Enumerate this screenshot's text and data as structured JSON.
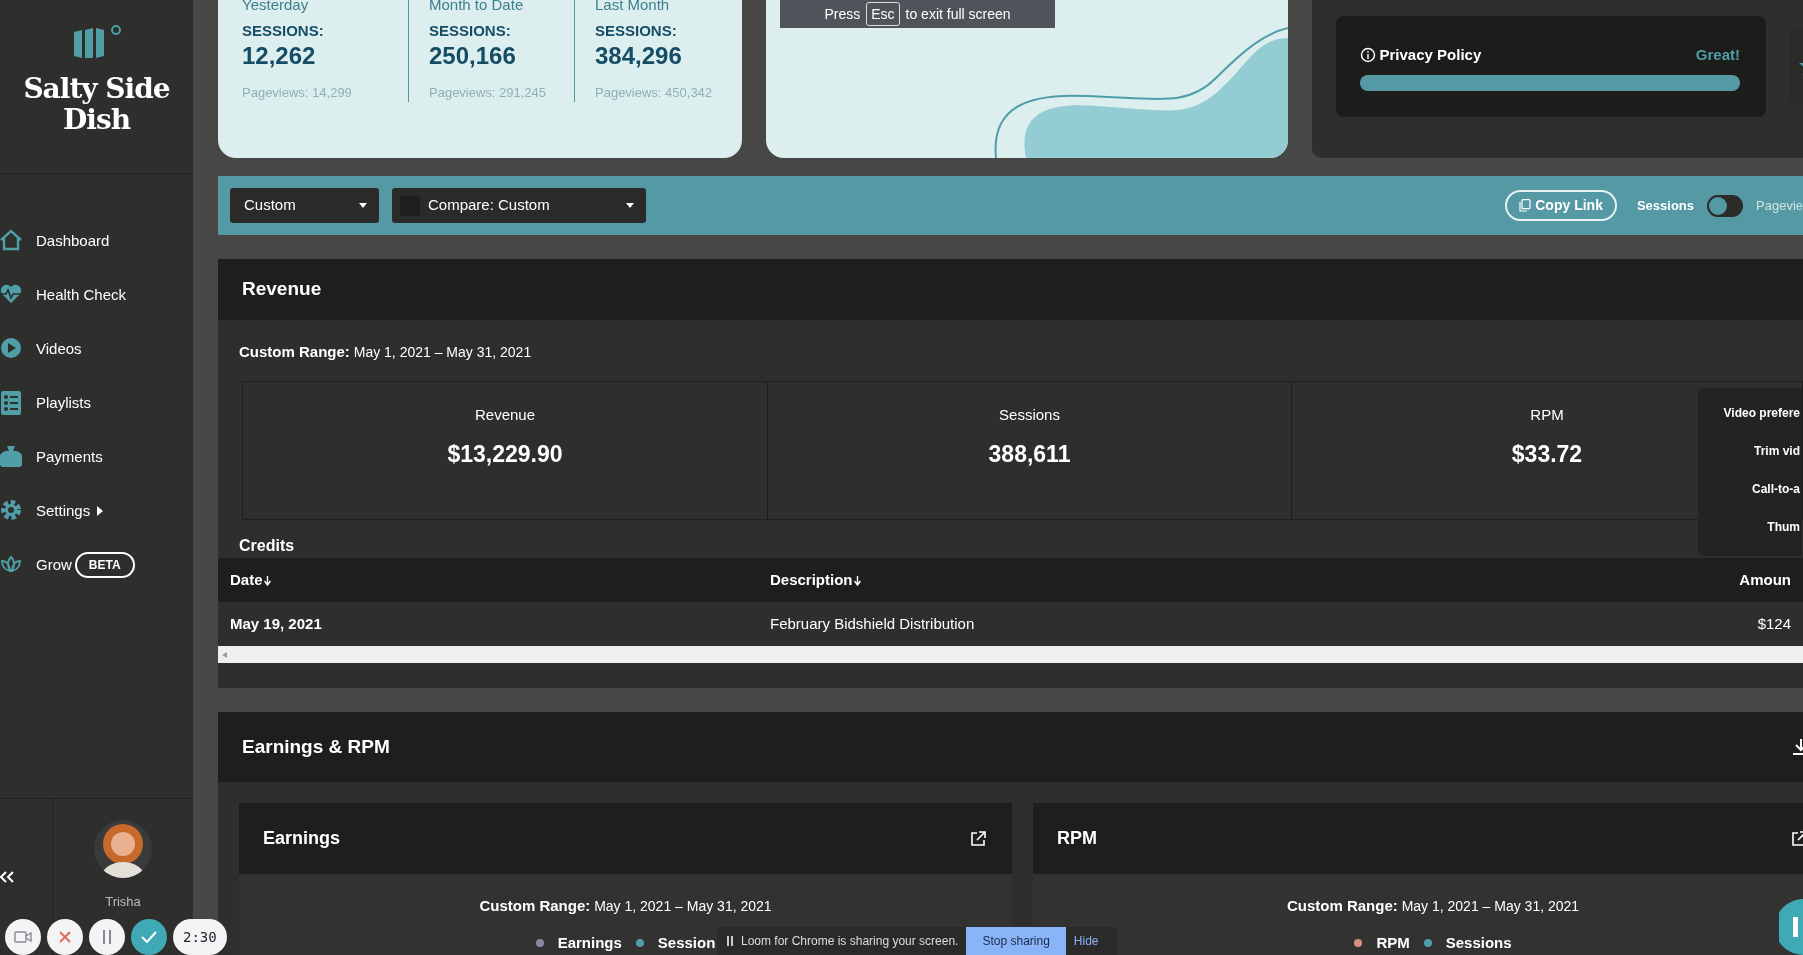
{
  "fullscreen_notice": {
    "before": "Press",
    "key": "Esc",
    "after": "to exit full screen"
  },
  "sidebar": {
    "brand": "Salty Side Dish",
    "items": [
      {
        "label": "Dashboard"
      },
      {
        "label": "Health Check"
      },
      {
        "label": "Videos"
      },
      {
        "label": "Playlists"
      },
      {
        "label": "Payments"
      },
      {
        "label": "Settings",
        "caret": true
      },
      {
        "label": "Grow",
        "badge": "BETA"
      }
    ],
    "user": {
      "name": "Trisha"
    }
  },
  "stats": [
    {
      "period": "Yesterday",
      "label": "SESSIONS:",
      "value": "12,262",
      "secondary": "Pageviews: 14,299"
    },
    {
      "period": "Month to Date",
      "label": "SESSIONS:",
      "value": "250,166",
      "secondary": "Pageviews: 291,245"
    },
    {
      "period": "Last Month",
      "label": "SESSIONS:",
      "value": "384,296",
      "secondary": "Pageviews: 450,342"
    }
  ],
  "privacy": {
    "label": "Privacy Policy",
    "status": "Great!",
    "level": 1
  },
  "toolbar": {
    "range": "Custom",
    "compare": "Compare: Custom",
    "copy_link": "Copy Link",
    "toggle_label": "Sessions",
    "toggle_on": false,
    "toggle_other": "Pagevie"
  },
  "revenue": {
    "title": "Revenue",
    "range_label": "Custom Range:",
    "range": "May 1, 2021 – May 31, 2021",
    "metrics": [
      {
        "label": "Revenue",
        "value": "$13,229.90"
      },
      {
        "label": "Sessions",
        "value": "388,611"
      },
      {
        "label": "RPM",
        "value": "$33.72"
      }
    ],
    "menu": [
      "Video prefere",
      "Trim vid",
      "Call-to-a",
      "Thum"
    ],
    "credits": {
      "title": "Credits",
      "columns": [
        {
          "label": "Date",
          "sorted": true
        },
        {
          "label": "Description",
          "sorted": true
        },
        {
          "label": "Amoun",
          "sorted": false
        }
      ],
      "rows": [
        [
          "May 19, 2021",
          "February Bidshield Distribution",
          "$124"
        ]
      ]
    }
  },
  "earnings": {
    "title": "Earnings & RPM",
    "cards": [
      {
        "title": "Earnings",
        "range_label": "Custom Range:",
        "range": "May 1, 2021 – May 31, 2021",
        "legend": [
          {
            "label": "Earnings",
            "color": "#8c86a6"
          },
          {
            "label": "Session",
            "color": "#4f9ea8"
          }
        ]
      },
      {
        "title": "RPM",
        "range_label": "Custom Range:",
        "range": "May 1, 2021 – May 31, 2021",
        "legend": [
          {
            "label": "RPM",
            "color": "#d9907a"
          },
          {
            "label": "Sessions",
            "color": "#4f9ea8"
          }
        ]
      }
    ]
  },
  "recorder": {
    "timer": "2:30"
  },
  "sharing_bar": {
    "message": "Loom for Chrome is sharing your screen.",
    "stop": "Stop sharing",
    "hide": "Hide"
  }
}
